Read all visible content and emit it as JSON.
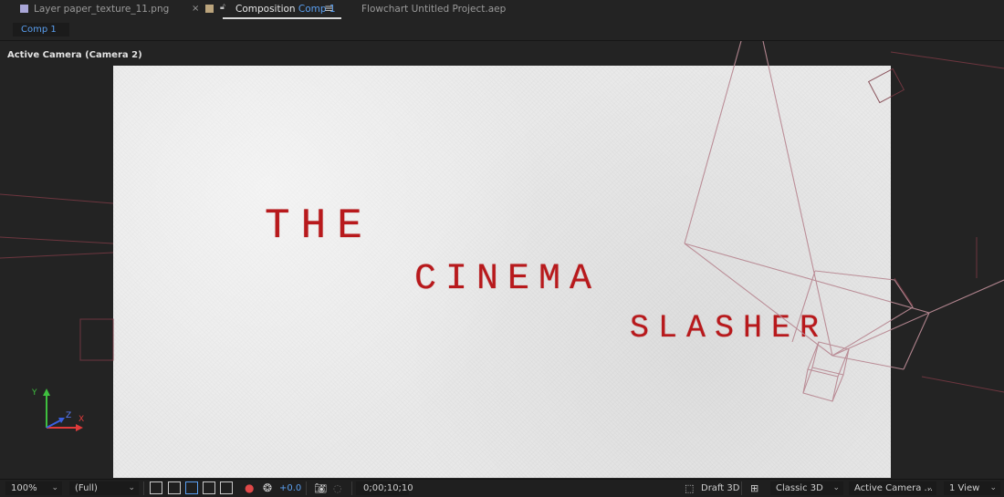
{
  "tabs": [
    {
      "type_label": "Layer",
      "name": "paper_texture_11.png",
      "swatch": "#a9a6d8"
    },
    {
      "type_label": "Composition",
      "name": "Comp 1",
      "swatch": "#bba47c"
    },
    {
      "type_label": "Flowchart",
      "name": "Untitled Project.aep"
    }
  ],
  "comp_pill": "Comp 1",
  "viewer": {
    "camera_label": "Active Camera (Camera 2)",
    "title_lines": [
      "THE",
      "CINEMA",
      "SLASHER"
    ],
    "title_color": "#b8191c",
    "axis_labels": {
      "y": "Y",
      "z": "Z",
      "x": "X"
    }
  },
  "bottom_bar": {
    "zoom": "100%",
    "resolution": "(Full)",
    "exposure": "+0.0",
    "timecode": "0;00;10;10",
    "renderer_draft": "Draft 3D",
    "renderer": "Classic 3D",
    "view": "Active Camera ...",
    "layout": "1 View"
  }
}
